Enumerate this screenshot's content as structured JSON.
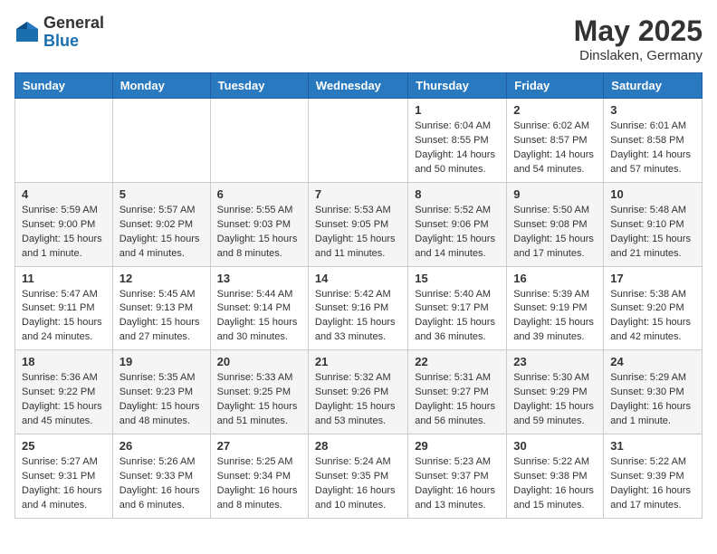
{
  "header": {
    "logo_general": "General",
    "logo_blue": "Blue",
    "month": "May 2025",
    "location": "Dinslaken, Germany"
  },
  "weekdays": [
    "Sunday",
    "Monday",
    "Tuesday",
    "Wednesday",
    "Thursday",
    "Friday",
    "Saturday"
  ],
  "weeks": [
    [
      {
        "day": "",
        "sunrise": "",
        "sunset": "",
        "daylight": ""
      },
      {
        "day": "",
        "sunrise": "",
        "sunset": "",
        "daylight": ""
      },
      {
        "day": "",
        "sunrise": "",
        "sunset": "",
        "daylight": ""
      },
      {
        "day": "",
        "sunrise": "",
        "sunset": "",
        "daylight": ""
      },
      {
        "day": "1",
        "sunrise": "Sunrise: 6:04 AM",
        "sunset": "Sunset: 8:55 PM",
        "daylight": "Daylight: 14 hours and 50 minutes."
      },
      {
        "day": "2",
        "sunrise": "Sunrise: 6:02 AM",
        "sunset": "Sunset: 8:57 PM",
        "daylight": "Daylight: 14 hours and 54 minutes."
      },
      {
        "day": "3",
        "sunrise": "Sunrise: 6:01 AM",
        "sunset": "Sunset: 8:58 PM",
        "daylight": "Daylight: 14 hours and 57 minutes."
      }
    ],
    [
      {
        "day": "4",
        "sunrise": "Sunrise: 5:59 AM",
        "sunset": "Sunset: 9:00 PM",
        "daylight": "Daylight: 15 hours and 1 minute."
      },
      {
        "day": "5",
        "sunrise": "Sunrise: 5:57 AM",
        "sunset": "Sunset: 9:02 PM",
        "daylight": "Daylight: 15 hours and 4 minutes."
      },
      {
        "day": "6",
        "sunrise": "Sunrise: 5:55 AM",
        "sunset": "Sunset: 9:03 PM",
        "daylight": "Daylight: 15 hours and 8 minutes."
      },
      {
        "day": "7",
        "sunrise": "Sunrise: 5:53 AM",
        "sunset": "Sunset: 9:05 PM",
        "daylight": "Daylight: 15 hours and 11 minutes."
      },
      {
        "day": "8",
        "sunrise": "Sunrise: 5:52 AM",
        "sunset": "Sunset: 9:06 PM",
        "daylight": "Daylight: 15 hours and 14 minutes."
      },
      {
        "day": "9",
        "sunrise": "Sunrise: 5:50 AM",
        "sunset": "Sunset: 9:08 PM",
        "daylight": "Daylight: 15 hours and 17 minutes."
      },
      {
        "day": "10",
        "sunrise": "Sunrise: 5:48 AM",
        "sunset": "Sunset: 9:10 PM",
        "daylight": "Daylight: 15 hours and 21 minutes."
      }
    ],
    [
      {
        "day": "11",
        "sunrise": "Sunrise: 5:47 AM",
        "sunset": "Sunset: 9:11 PM",
        "daylight": "Daylight: 15 hours and 24 minutes."
      },
      {
        "day": "12",
        "sunrise": "Sunrise: 5:45 AM",
        "sunset": "Sunset: 9:13 PM",
        "daylight": "Daylight: 15 hours and 27 minutes."
      },
      {
        "day": "13",
        "sunrise": "Sunrise: 5:44 AM",
        "sunset": "Sunset: 9:14 PM",
        "daylight": "Daylight: 15 hours and 30 minutes."
      },
      {
        "day": "14",
        "sunrise": "Sunrise: 5:42 AM",
        "sunset": "Sunset: 9:16 PM",
        "daylight": "Daylight: 15 hours and 33 minutes."
      },
      {
        "day": "15",
        "sunrise": "Sunrise: 5:40 AM",
        "sunset": "Sunset: 9:17 PM",
        "daylight": "Daylight: 15 hours and 36 minutes."
      },
      {
        "day": "16",
        "sunrise": "Sunrise: 5:39 AM",
        "sunset": "Sunset: 9:19 PM",
        "daylight": "Daylight: 15 hours and 39 minutes."
      },
      {
        "day": "17",
        "sunrise": "Sunrise: 5:38 AM",
        "sunset": "Sunset: 9:20 PM",
        "daylight": "Daylight: 15 hours and 42 minutes."
      }
    ],
    [
      {
        "day": "18",
        "sunrise": "Sunrise: 5:36 AM",
        "sunset": "Sunset: 9:22 PM",
        "daylight": "Daylight: 15 hours and 45 minutes."
      },
      {
        "day": "19",
        "sunrise": "Sunrise: 5:35 AM",
        "sunset": "Sunset: 9:23 PM",
        "daylight": "Daylight: 15 hours and 48 minutes."
      },
      {
        "day": "20",
        "sunrise": "Sunrise: 5:33 AM",
        "sunset": "Sunset: 9:25 PM",
        "daylight": "Daylight: 15 hours and 51 minutes."
      },
      {
        "day": "21",
        "sunrise": "Sunrise: 5:32 AM",
        "sunset": "Sunset: 9:26 PM",
        "daylight": "Daylight: 15 hours and 53 minutes."
      },
      {
        "day": "22",
        "sunrise": "Sunrise: 5:31 AM",
        "sunset": "Sunset: 9:27 PM",
        "daylight": "Daylight: 15 hours and 56 minutes."
      },
      {
        "day": "23",
        "sunrise": "Sunrise: 5:30 AM",
        "sunset": "Sunset: 9:29 PM",
        "daylight": "Daylight: 15 hours and 59 minutes."
      },
      {
        "day": "24",
        "sunrise": "Sunrise: 5:29 AM",
        "sunset": "Sunset: 9:30 PM",
        "daylight": "Daylight: 16 hours and 1 minute."
      }
    ],
    [
      {
        "day": "25",
        "sunrise": "Sunrise: 5:27 AM",
        "sunset": "Sunset: 9:31 PM",
        "daylight": "Daylight: 16 hours and 4 minutes."
      },
      {
        "day": "26",
        "sunrise": "Sunrise: 5:26 AM",
        "sunset": "Sunset: 9:33 PM",
        "daylight": "Daylight: 16 hours and 6 minutes."
      },
      {
        "day": "27",
        "sunrise": "Sunrise: 5:25 AM",
        "sunset": "Sunset: 9:34 PM",
        "daylight": "Daylight: 16 hours and 8 minutes."
      },
      {
        "day": "28",
        "sunrise": "Sunrise: 5:24 AM",
        "sunset": "Sunset: 9:35 PM",
        "daylight": "Daylight: 16 hours and 10 minutes."
      },
      {
        "day": "29",
        "sunrise": "Sunrise: 5:23 AM",
        "sunset": "Sunset: 9:37 PM",
        "daylight": "Daylight: 16 hours and 13 minutes."
      },
      {
        "day": "30",
        "sunrise": "Sunrise: 5:22 AM",
        "sunset": "Sunset: 9:38 PM",
        "daylight": "Daylight: 16 hours and 15 minutes."
      },
      {
        "day": "31",
        "sunrise": "Sunrise: 5:22 AM",
        "sunset": "Sunset: 9:39 PM",
        "daylight": "Daylight: 16 hours and 17 minutes."
      }
    ]
  ]
}
